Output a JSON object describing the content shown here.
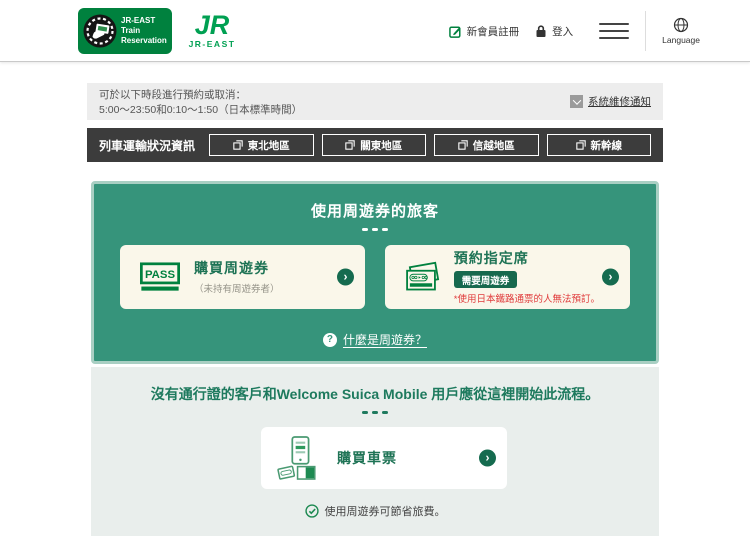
{
  "colors": {
    "brand-green": "#00813E",
    "panel-green": "#36947B",
    "panel-border": "#A9CFC3",
    "dark-green": "#156B4F",
    "title-green": "#1E7355",
    "cream": "#FAF7EA",
    "dark-bar": "#3C3C3C",
    "notice-bg": "#EDEDED",
    "section-bg": "#E9EEEC",
    "alert-red": "#E03C3C"
  },
  "header": {
    "logo_lines": [
      "JR-EAST",
      "Train",
      "Reservation"
    ],
    "jr_mark": "JR",
    "jr_label": "JR-EAST",
    "register_label": "新會員註冊",
    "login_label": "登入",
    "language_label": "Language"
  },
  "icons": {
    "register": "pencil-square",
    "login": "lock",
    "menu": "hamburger",
    "language": "globe",
    "maintenance": "chevron-down",
    "status_buttons": "external-link",
    "cards": "chevron-right-circle",
    "what_is_pass": "question-circle",
    "tip": "check-circle"
  },
  "notice": {
    "line1": "可於以下時段進行預約或取消：",
    "line2": "5:00～23:50和0:10～1:50（日本標準時間）",
    "maintenance_link": "系統維修通知"
  },
  "train_status": {
    "label": "列車運輸狀況資訊",
    "buttons": [
      "東北地區",
      "關東地區",
      "信越地區",
      "新幹線"
    ]
  },
  "pass_section": {
    "title": "使用周遊券的旅客",
    "cards": [
      {
        "icon_label": "PASS",
        "title": "購買周遊券",
        "subtitle": "（未持有周遊券者）"
      },
      {
        "title": "預約指定席",
        "badge": "需要周遊券",
        "note": "*使用日本鐵路通票的人無法預訂。"
      }
    ],
    "what_is_pass_link": "什麼是周遊券？"
  },
  "no_pass_section": {
    "heading": "沒有通行證的客戶和Welcome Suica Mobile 用戶應從這裡開始此流程。",
    "card_title": "購買車票",
    "tip": "使用周遊券可節省旅費。"
  }
}
